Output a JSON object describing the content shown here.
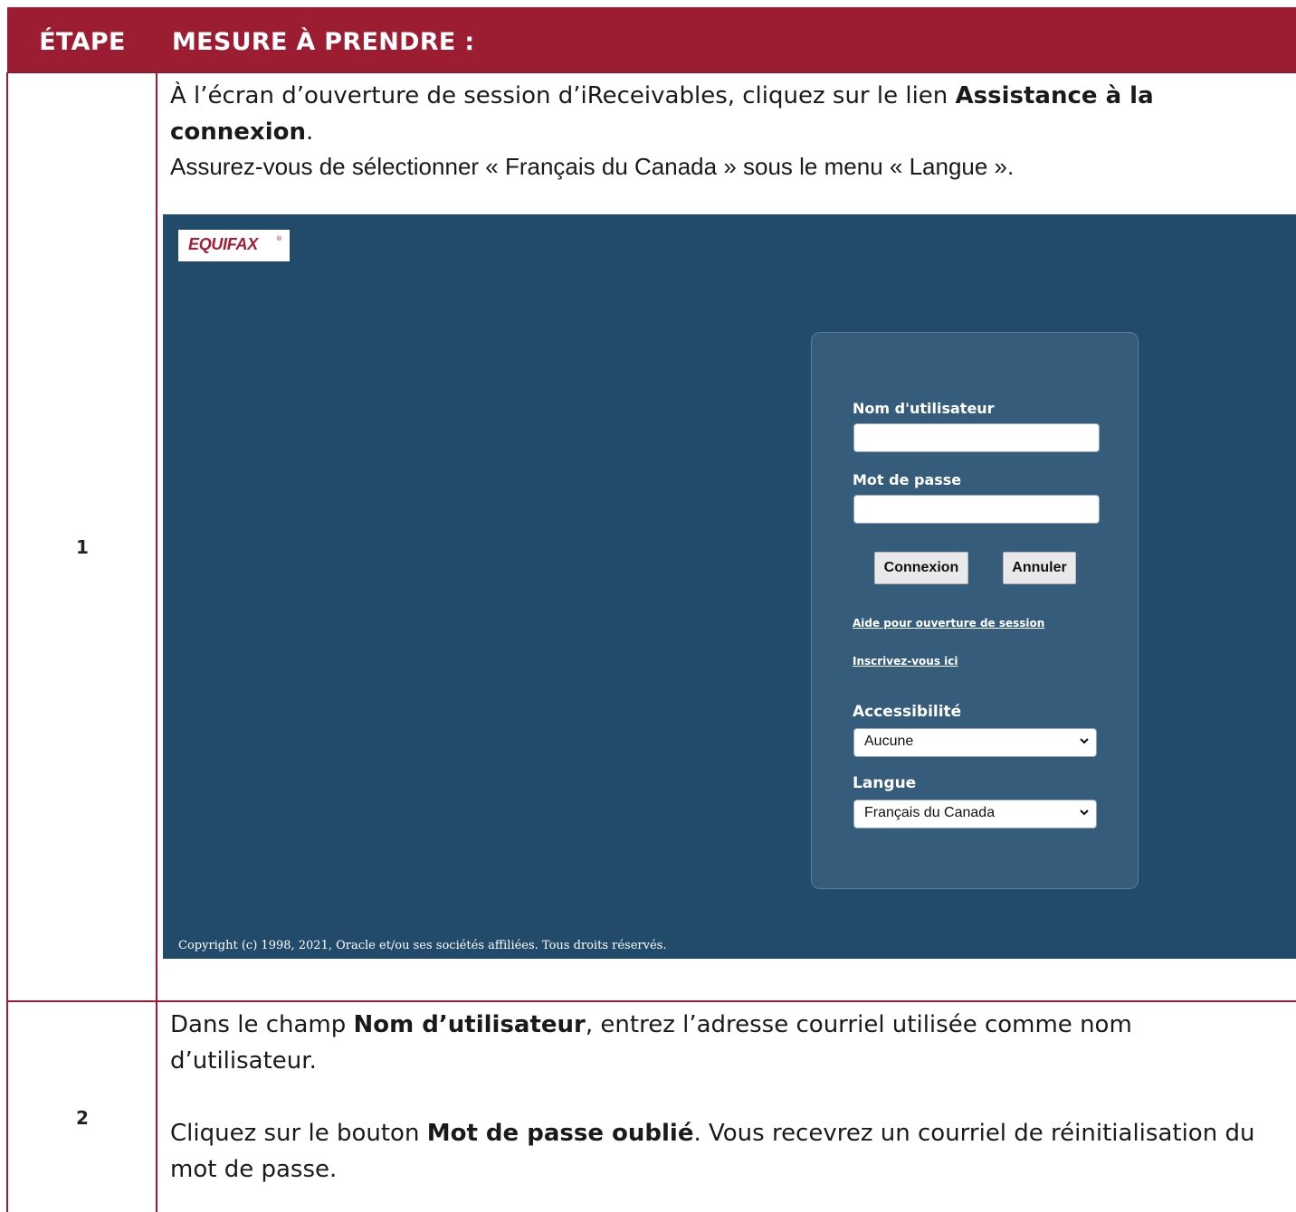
{
  "header": {
    "step_label": "ÉTAPE",
    "action_label": "MESURE À PRENDRE :"
  },
  "rows": [
    {
      "step": "1",
      "line1_pre": "À l’écran d’ouverture de session d’iReceivables, cliquez sur le lien ",
      "line1_bold": "Assistance à la connexion",
      "line1_post": ".",
      "line2": "Assurez-vous de sélectionner « Français du Canada » sous le menu « Langue »."
    },
    {
      "step": "2",
      "p1_pre": "Dans le champ ",
      "p1_bold": "Nom d’utilisateur",
      "p1_post": ", entrez l’adresse courriel utilisée comme nom d’utilisateur.",
      "p2_pre": "Cliquez sur le bouton ",
      "p2_bold": "Mot de passe oublié",
      "p2_post": ". Vous recevrez un courriel de réinitialisation du mot de passe."
    }
  ],
  "screenshot": {
    "logo_text": "EQUIFAX",
    "logo_mark": "®",
    "username_label": "Nom d'utilisateur",
    "username_value": "",
    "password_label": "Mot de passe",
    "password_value": "",
    "login_button": "Connexion",
    "cancel_button": "Annuler",
    "help_link": "Aide pour ouverture de session",
    "register_link": "Inscrivez-vous ici",
    "accessibility_label": "Accessibilité",
    "accessibility_value": "Aucune",
    "language_label": "Langue",
    "language_value": "Français du Canada",
    "copyright": "Copyright (c) 1998, 2021, Oracle et/ou ses sociétés affiliées. Tous droits réservés.",
    "colors": {
      "background": "#224b6b",
      "panel": "#365c7c",
      "brand_red": "#a61c33"
    }
  },
  "colors": {
    "header_bg": "#9c1c31",
    "header_text": "#ffffff"
  }
}
